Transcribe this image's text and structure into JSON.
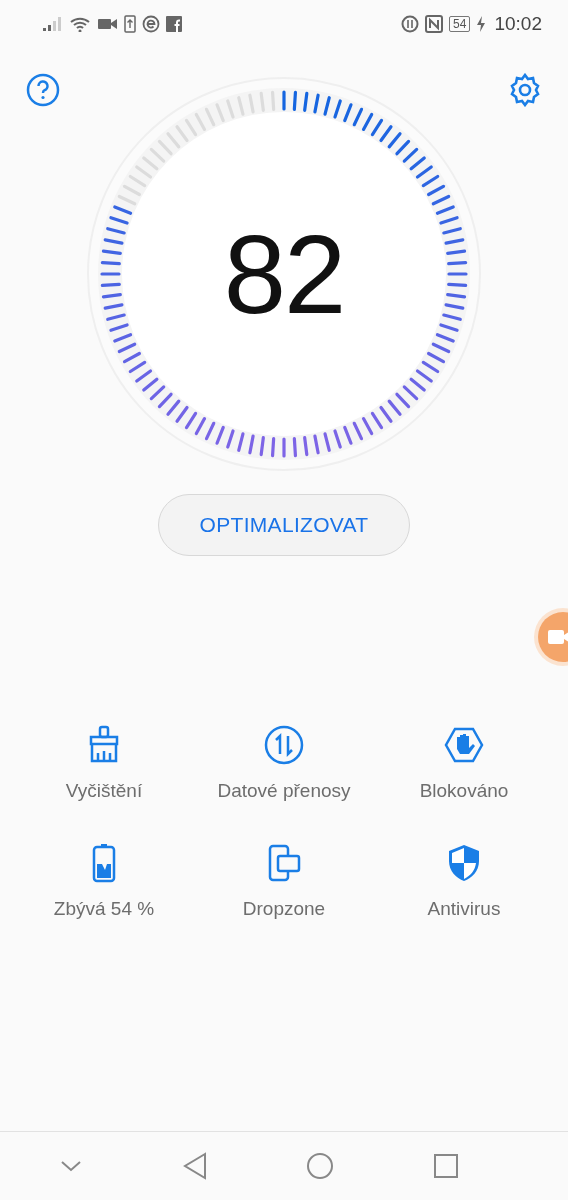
{
  "status_bar": {
    "battery": "54",
    "time": "10:02"
  },
  "gauge": {
    "score": "82"
  },
  "optimize_button": "OPTIMALIZOVAT",
  "tools": [
    {
      "kind": "cleanup",
      "label": "Vyčištění"
    },
    {
      "kind": "data",
      "label": "Datové přenosy"
    },
    {
      "kind": "blocked",
      "label": "Blokováno"
    },
    {
      "kind": "battery",
      "label": "Zbývá 54 %"
    },
    {
      "kind": "dropzone",
      "label": "Dropzone"
    },
    {
      "kind": "antivirus",
      "label": "Antivirus"
    }
  ]
}
